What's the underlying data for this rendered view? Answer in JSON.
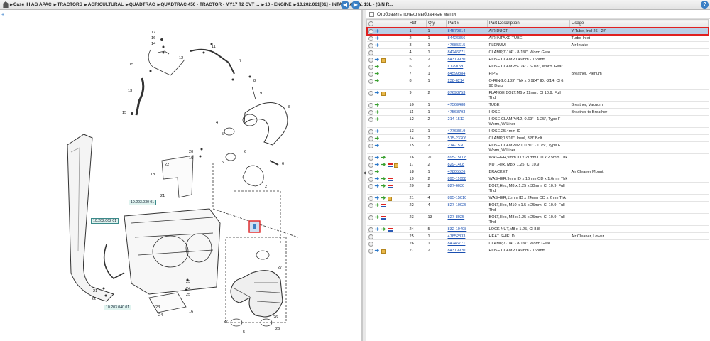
{
  "breadcrumb": [
    "Case IH AG APAC",
    "TRACTORS",
    "AGRICULTURAL",
    "QUADTRAC",
    "QUADTRAC 450 - TRACTOR - MY17 T2 CVT ...",
    "10 - ENGINE",
    "10.202.061[01] - INTAKE ASSY, 13L - (S/N R..."
  ],
  "nav": {
    "prev": "◀",
    "next": "▶",
    "help": "?"
  },
  "filter_label": "Отобразить только выбранные метки",
  "table": {
    "columns": [
      "Ref",
      "Qty",
      "Part #",
      "Part Description",
      "Usage"
    ],
    "rows": [
      {
        "ref": "1",
        "qty": "1",
        "part": "84579314",
        "desc": "AIR DUCT",
        "usage": "Y-Tube, Incl 26 - 27",
        "icons": [
          "plus",
          "info"
        ],
        "selected": true
      },
      {
        "ref": "2",
        "qty": "1",
        "part": "84426356",
        "desc": "AIR INTAKE TUBE",
        "usage": "Turbo Inlet",
        "icons": [
          "plus",
          "info"
        ]
      },
      {
        "ref": "3",
        "qty": "1",
        "part": "47685615",
        "desc": "PLENUM",
        "usage": "Air Intake",
        "icons": [
          "plus",
          "info"
        ]
      },
      {
        "ref": "4",
        "qty": "1",
        "part": "84246771",
        "desc": "CLAMP,7-1/4\" - 8-1/8\", Worm Gear",
        "usage": "",
        "icons": [
          "plus"
        ]
      },
      {
        "ref": "5",
        "qty": "2",
        "part": "84319920",
        "desc": "HOSE CLAMP,146mm - 168mm",
        "usage": "",
        "icons": [
          "plus",
          "info",
          "box"
        ]
      },
      {
        "ref": "6",
        "qty": "2",
        "part": "L129159",
        "desc": "HOSE CLAMP,5-1/4\" - 6-1/8\", Worm Gear",
        "usage": "",
        "icons": [
          "plus",
          "go"
        ]
      },
      {
        "ref": "7",
        "qty": "1",
        "part": "84599884",
        "desc": "PIPE",
        "usage": "Breather, Plenum",
        "icons": [
          "plus",
          "go"
        ]
      },
      {
        "ref": "8",
        "qty": "1",
        "part": "238-6214",
        "desc": "O-RING,0.139\" Thk x 0.984\" ID, -214, Cl 6, 90 Duro",
        "usage": "",
        "icons": [
          "plus",
          "go"
        ]
      },
      {
        "ref": "9",
        "qty": "2",
        "part": "87698753",
        "desc": "FLANGE BOLT,M6 x 12mm, Cl 10.9, Full Thd",
        "usage": "",
        "icons": [
          "plus",
          "info",
          "box"
        ]
      },
      {
        "ref": "10",
        "qty": "1",
        "part": "47569488",
        "desc": "TUBE",
        "usage": "Breather, Vacuum",
        "icons": [
          "plus",
          "go"
        ]
      },
      {
        "ref": "11",
        "qty": "1",
        "part": "47568793",
        "desc": "HOSE",
        "usage": "Breather to Breather",
        "icons": [
          "plus",
          "go"
        ]
      },
      {
        "ref": "12",
        "qty": "2",
        "part": "214-1512",
        "desc": "HOSE CLAMP,#12, 0.69\" - 1.25\", Type F Worm, W Liner",
        "usage": "",
        "icons": [
          "plus",
          "go"
        ]
      },
      {
        "ref": "13",
        "qty": "1",
        "part": "47768819",
        "desc": "HOSE,25.4mm ID",
        "usage": "",
        "icons": [
          "plus",
          "info"
        ]
      },
      {
        "ref": "14",
        "qty": "2",
        "part": "515-23206",
        "desc": "CLAMP,13/16\", Insul, 3/8\" Bolt",
        "usage": "",
        "icons": [
          "plus",
          "go"
        ]
      },
      {
        "ref": "15",
        "qty": "2",
        "part": "214-1520",
        "desc": "HOSE CLAMP,#20, 0.81\" - 1.75\", Type F Worm, W Liner",
        "usage": "",
        "icons": [
          "plus",
          "info"
        ]
      },
      {
        "ref": "16",
        "qty": "20",
        "part": "895-15008",
        "desc": "WASHER,9mm ID x 21mm OD x 2.5mm Thk",
        "usage": "",
        "icons": [
          "plus",
          "info",
          "go"
        ]
      },
      {
        "ref": "17",
        "qty": "2",
        "part": "829-1408",
        "desc": "NUT,Hex, M8 x 1.25, Cl 10.9",
        "usage": "",
        "icons": [
          "plus",
          "info",
          "go",
          "flag",
          "box"
        ]
      },
      {
        "ref": "18",
        "qty": "1",
        "part": "47805526",
        "desc": "BRACKET",
        "usage": "Air Cleaner Mount",
        "icons": [
          "plus",
          "go"
        ]
      },
      {
        "ref": "19",
        "qty": "2",
        "part": "895-11008",
        "desc": "WASHER,9mm ID x 16mm OD x 1.6mm Thk",
        "usage": "",
        "icons": [
          "plus",
          "info",
          "go",
          "flag"
        ]
      },
      {
        "ref": "20",
        "qty": "2",
        "part": "827-6030",
        "desc": "BOLT,Hex, M8 x 1.25 x 30mm, Cl 10.9, Full Thd",
        "usage": "",
        "icons": [
          "plus",
          "info",
          "go",
          "flag"
        ]
      },
      {
        "ref": "21",
        "qty": "4",
        "part": "895-15010",
        "desc": "WASHER,11mm ID x 24mm OD x 2mm Thk",
        "usage": "",
        "icons": [
          "plus",
          "info",
          "go",
          "box"
        ]
      },
      {
        "ref": "22",
        "qty": "4",
        "part": "827-10025",
        "desc": "BOLT,Hex, M10 x 1.5 x 25mm, Cl 10.9, Full Thd",
        "usage": "",
        "icons": [
          "plus",
          "go",
          "flag"
        ]
      },
      {
        "ref": "23",
        "qty": "13",
        "part": "827-8025",
        "desc": "BOLT,Hex, M8 x 1.25 x 25mm, Cl 10.9, Full Thd",
        "usage": "",
        "icons": [
          "plus",
          "go",
          "flag"
        ]
      },
      {
        "ref": "24",
        "qty": "5",
        "part": "832-10408",
        "desc": "LOCK NUT,M8 x 1.25, Cl 8.8",
        "usage": "",
        "icons": [
          "plus",
          "info",
          "go",
          "flag"
        ]
      },
      {
        "ref": "25",
        "qty": "1",
        "part": "47852833",
        "desc": "HEAT SHIELD",
        "usage": "Air Cleaner, Lower",
        "icons": [
          "plus"
        ]
      },
      {
        "ref": "26",
        "qty": "1",
        "part": "84246771",
        "desc": "CLAMP,7-1/4\" - 8-1/8\", Worm Gear",
        "usage": "",
        "icons": [
          "plus"
        ]
      },
      {
        "ref": "27",
        "qty": "2",
        "part": "84319920",
        "desc": "HOSE CLAMP,146mm - 168mm",
        "usage": "",
        "icons": [
          "plus",
          "info",
          "box"
        ]
      }
    ]
  },
  "diagram": {
    "callouts": [
      "10.203.030 01",
      "10.202.062 01",
      "10.203.040 01"
    ],
    "labels": [
      "17",
      "16",
      "15",
      "14",
      "13",
      "12",
      "11",
      "10",
      "9",
      "8",
      "7",
      "6",
      "5",
      "4",
      "3",
      "2",
      "1",
      "18",
      "19",
      "20",
      "21",
      "22",
      "23",
      "24",
      "25",
      "26",
      "27"
    ]
  }
}
